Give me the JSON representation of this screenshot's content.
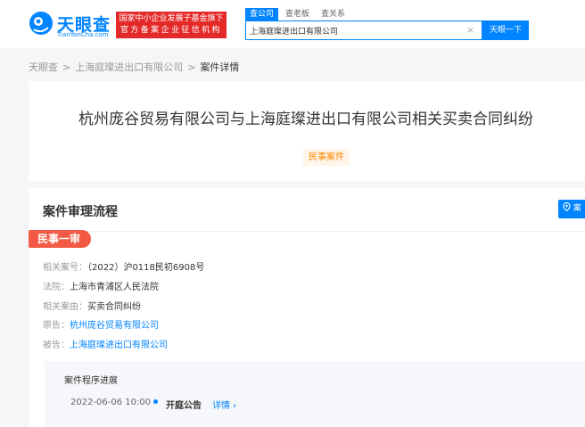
{
  "header": {
    "logo_text": "天眼查",
    "logo_sub": "TianYanCha.com",
    "badge_line1": "国家中小企业发展子基金旗下",
    "badge_line2": "官方备案企业征信机构",
    "tabs": [
      {
        "label": "查公司",
        "active": true
      },
      {
        "label": "查老板",
        "active": false
      },
      {
        "label": "查关系",
        "active": false
      }
    ],
    "search_value": "上海庭璨进出口有限公司",
    "clear_icon": "×",
    "search_button": "天眼一下"
  },
  "breadcrumb": {
    "items": [
      "天眼查",
      "上海庭璨进出口有限公司",
      "案件详情"
    ],
    "separator": ">"
  },
  "case": {
    "title": "杭州庞谷贸易有限公司与上海庭璨进出口有限公司相关买卖合同纠纷",
    "tag": "民事案件"
  },
  "process": {
    "section_title": "案件审理流程",
    "button_label": "案",
    "stage": "民事一审",
    "fields": [
      {
        "label": "相关案号：",
        "value": "（2022）沪0118民初6908号",
        "link": false
      },
      {
        "label": "法院：",
        "value": "上海市青浦区人民法院",
        "link": false
      },
      {
        "label": "相关案由：",
        "value": "买卖合同纠纷",
        "link": false
      },
      {
        "label": "原告：",
        "value": "杭州庞谷贸易有限公司",
        "link": true
      },
      {
        "label": "被告：",
        "value": "上海庭璨进出口有限公司",
        "link": true
      }
    ],
    "progress_title": "案件程序进展",
    "progress_date": "2022-06-06 10:00",
    "progress_event": "开庭公告",
    "progress_link": "详情 ›"
  },
  "colors": {
    "brand": "#0084ff",
    "badge_red": "#e32a28",
    "stage_red": "#f25a45",
    "tag_orange": "#ff8c00"
  }
}
